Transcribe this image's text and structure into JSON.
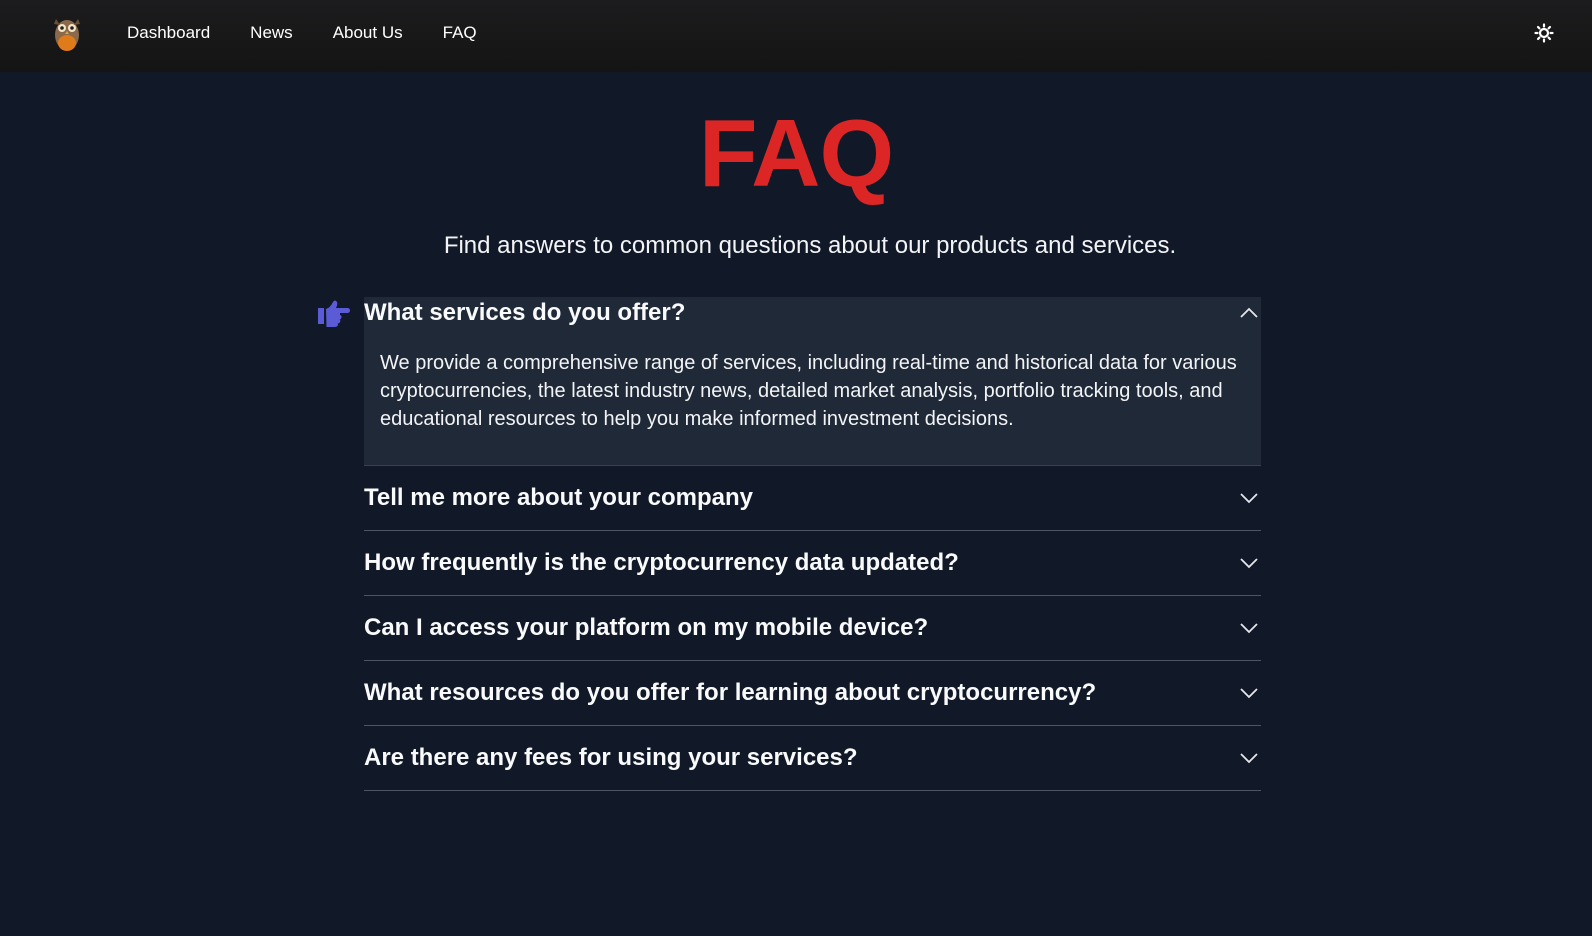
{
  "nav": {
    "links": [
      "Dashboard",
      "News",
      "About Us",
      "FAQ"
    ],
    "logo_icon": "owl-logo-icon",
    "theme_icon": "sun-icon"
  },
  "page": {
    "title": "FAQ",
    "subtitle": "Find answers to common questions about our products and services.",
    "accent_color": "#dc2626",
    "pointer_icon": "pointing-hand-icon"
  },
  "faq": [
    {
      "question": "What services do you offer?",
      "answer": "We provide a comprehensive range of services, including real-time and historical data for various cryptocurrencies, the latest industry news, detailed market analysis, portfolio tracking tools, and educational resources to help you make informed investment decisions.",
      "expanded": true
    },
    {
      "question": "Tell me more about your company",
      "expanded": false
    },
    {
      "question": "How frequently is the cryptocurrency data updated?",
      "expanded": false
    },
    {
      "question": "Can I access your platform on my mobile device?",
      "expanded": false
    },
    {
      "question": "What resources do you offer for learning about cryptocurrency?",
      "expanded": false
    },
    {
      "question": "Are there any fees for using your services?",
      "expanded": false
    }
  ]
}
